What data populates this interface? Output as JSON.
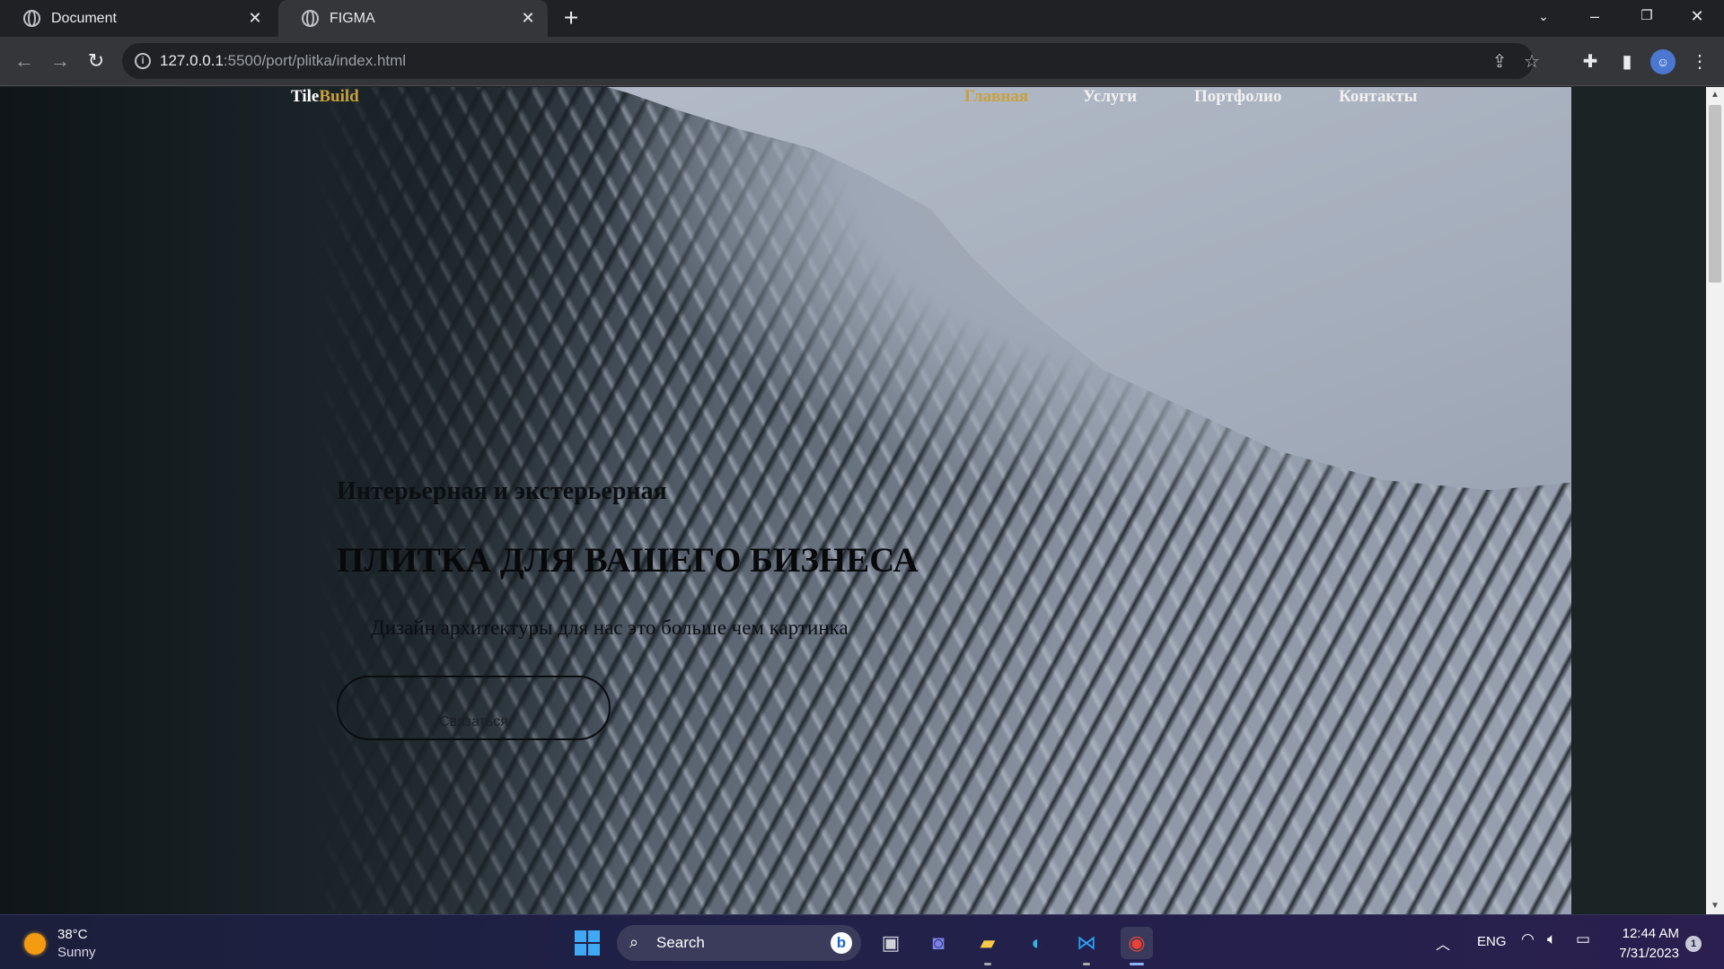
{
  "browser": {
    "tabs": [
      {
        "title": "Document",
        "active": false,
        "icon": "globe-icon"
      },
      {
        "title": "FIGMA",
        "active": true,
        "icon": "globe-icon"
      }
    ],
    "new_tab_icon": "plus-icon",
    "url_host": "127.0.0.1",
    "url_rest": ":5500/port/plitka/index.html"
  },
  "page": {
    "logo_part1": "Tile",
    "logo_part2": "Build",
    "nav": [
      {
        "label": "Главная",
        "active": true
      },
      {
        "label": "Услуги",
        "active": false
      },
      {
        "label": "Портфолио",
        "active": false
      },
      {
        "label": "Контакты",
        "active": false
      }
    ],
    "hero_subtitle": "Интерьерная и экстерьерная",
    "hero_title": "ПЛИТКА ДЛЯ ВАШЕГО БИЗНЕСА",
    "hero_description": "Дизайн архитектуры для нас это больше чем картинка",
    "hero_button": "Связаться",
    "accent_color": "#c9a13a"
  },
  "taskbar": {
    "weather_temp": "38°C",
    "weather_desc": "Sunny",
    "search_label": "Search",
    "language": "ENG",
    "time": "12:44 AM",
    "date": "7/31/2023",
    "notification_count": "1"
  }
}
